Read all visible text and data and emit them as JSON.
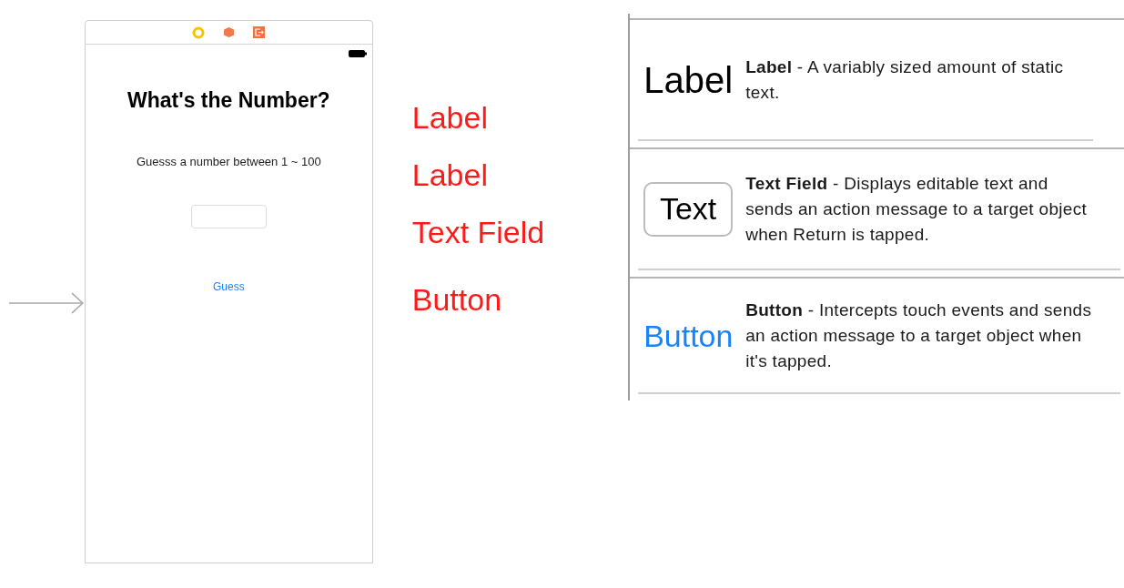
{
  "scene": {
    "title": "What's the Number?",
    "subtitle": "Guesss a number between 1 ~ 100",
    "button": "Guess"
  },
  "annotations": [
    "Label",
    "Label",
    "Text Field",
    "Button"
  ],
  "library": [
    {
      "kind": "label",
      "preview": "Label",
      "description": "**Label** - A variably sized amount of static text."
    },
    {
      "kind": "field",
      "preview": "Text",
      "description": "**Text Field** - Displays editable text and sends an action message to a target object when Return is tapped."
    },
    {
      "kind": "button",
      "preview": "Button",
      "description": "**Button** - Intercepts touch events and sends an action message to a target object when it's tapped."
    }
  ]
}
